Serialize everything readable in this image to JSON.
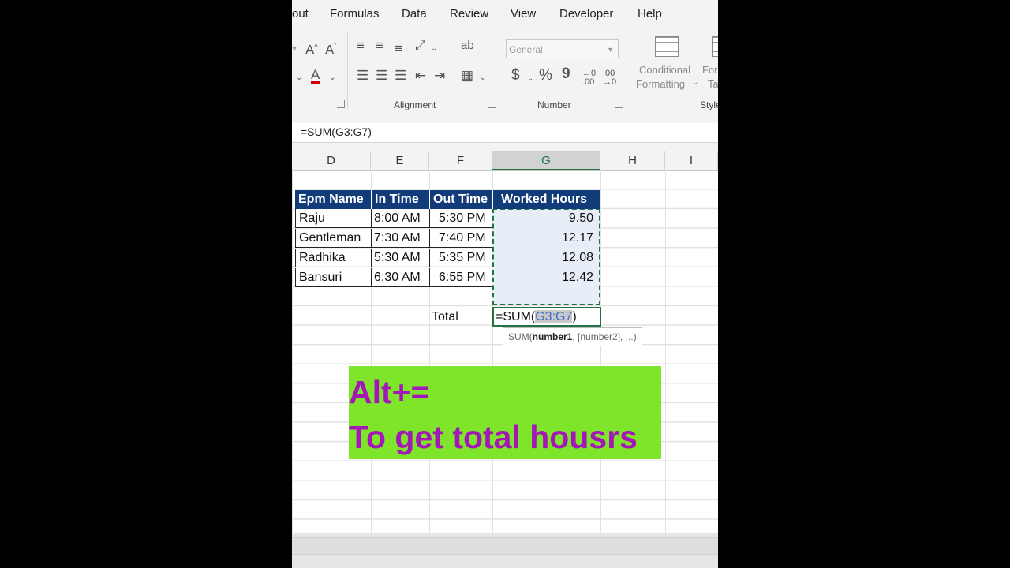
{
  "ribbon": {
    "tabs": [
      "out",
      "Formulas",
      "Data",
      "Review",
      "View",
      "Developer",
      "Help"
    ],
    "groups": {
      "alignment": "Alignment",
      "number": "Number",
      "styles": "Style"
    },
    "number_format": "General",
    "currency_symbol": "$",
    "percent_symbol": "%",
    "comma_symbol": "9",
    "conditional_formatting": [
      "Conditional",
      "Formatting"
    ],
    "format_as_table": [
      "For",
      "Ta"
    ]
  },
  "formula_bar": {
    "value": "=SUM(G3:G7)"
  },
  "columns": [
    "D",
    "E",
    "F",
    "G",
    "H",
    "I"
  ],
  "table": {
    "headers": [
      "Epm Name",
      "In Time",
      "Out Time",
      "Worked Hours"
    ],
    "rows": [
      [
        "Raju",
        "8:00 AM",
        "5:30 PM",
        "9.50"
      ],
      [
        "Gentleman",
        "7:30 AM",
        "7:40 PM",
        "12.17"
      ],
      [
        "Radhika",
        "5:30 AM",
        "5:35 PM",
        "12.08"
      ],
      [
        "Bansuri",
        "6:30 AM",
        "6:55 PM",
        "12.42"
      ]
    ],
    "total_label": "Total",
    "formula_prefix": "=SUM(",
    "formula_ref": "G3:G7",
    "formula_suffix": ")"
  },
  "tooltip": {
    "func": "SUM(",
    "arg1": "number1",
    "rest": ", [number2], ...)"
  },
  "banner": {
    "line1": "Alt+=",
    "line2": "To get total housrs"
  },
  "colors": {
    "header_fill": "#123b7a",
    "accent": "#217346",
    "banner_bg": "#7ee52a",
    "banner_text": "#a316b8"
  }
}
